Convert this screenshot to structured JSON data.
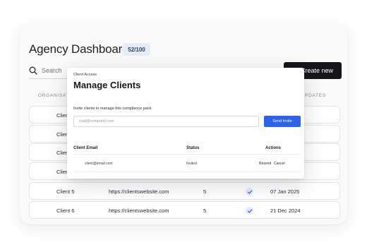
{
  "header": {
    "title": "Agency Dashboard",
    "count_badge": "52/100"
  },
  "search": {
    "label": "Search",
    "icon": "search-icon"
  },
  "toolbar": {
    "create_label": "Create new"
  },
  "table": {
    "headers": {
      "organisation": "ORGANISATI",
      "updates": "PDATES"
    },
    "rows": [
      {
        "name": "Client"
      },
      {
        "name": "Client"
      },
      {
        "name": "Client"
      },
      {
        "name": "Client"
      },
      {
        "name": "Client 5",
        "url": "https://clientswebsite.com",
        "count": "5",
        "checked": true,
        "date": "07 Jan 2025"
      },
      {
        "name": "Client 6",
        "url": "https://clientswebsite.com",
        "count": "5",
        "checked": true,
        "date": "21 Dec 2024"
      }
    ]
  },
  "modal": {
    "eyebrow": "Client Access",
    "title": "Manage Clients",
    "subtitle": "Invite clients to manage this compliance pack",
    "email_placeholder": "mail@company.com",
    "send_label": "Send Invite",
    "columns": {
      "email": "Client Email",
      "status": "Status",
      "actions": "Actions"
    },
    "invites": [
      {
        "email": "client@email.com",
        "status": "Invited",
        "resend": "Resend",
        "cancel": "Cancel"
      }
    ]
  },
  "colors": {
    "accent": "#2c63e8",
    "primary_button": "#15151a",
    "badge_bg": "#e6edf8"
  }
}
